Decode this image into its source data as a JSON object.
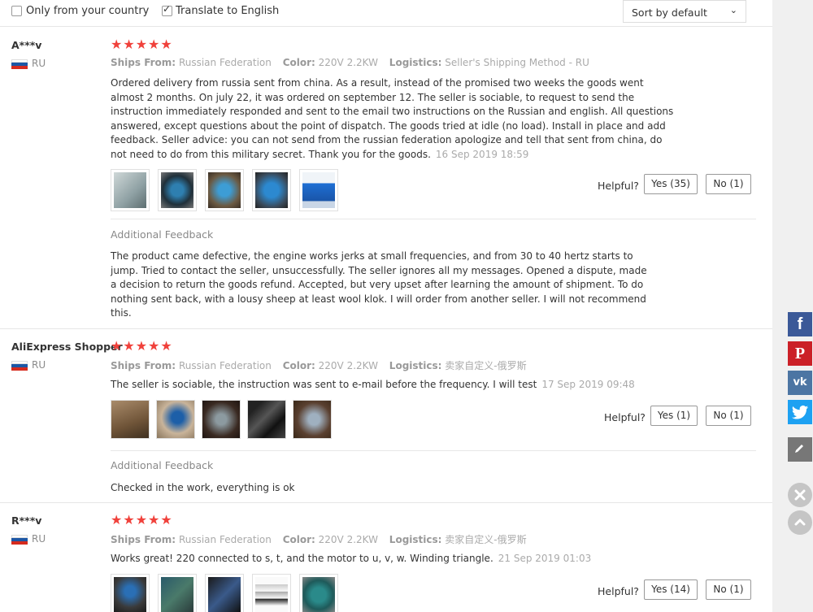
{
  "filters": {
    "only_country_label": "Only from your country",
    "translate_label": "Translate to English",
    "sort_value": "Sort by default"
  },
  "labels": {
    "ships_from": "Ships From:",
    "color": "Color:",
    "logistics": "Logistics:",
    "helpful": "Helpful?",
    "additional_feedback": "Additional Feedback"
  },
  "reviews": [
    {
      "user": "A***v",
      "country": "RU",
      "stars": "★★★★★",
      "ships_from": "Russian Federation",
      "color": "220V 2.2KW",
      "logistics": "Seller's Shipping Method - RU",
      "text": "Ordered delivery from russia sent from china. As a result, instead of the promised two weeks the goods went almost 2 months. On july 22, it was ordered on september 12. The seller is sociable, to request to send the instruction immediately responded and sent to the email two instructions on the Russian and english. All questions answered, except questions about the point of dispatch. The goods tried at idle (no load). Install in place and add feedback. Seller advice: you can not send from the russian federation apologize and tell that sent from china, do not need to do from this military secret. Thank you for the goods.",
      "time": "16 Sep 2019 18:59",
      "yes": "Yes (35)",
      "no": "No (1)",
      "additional": "The product came defective, the engine works jerks at small frequencies, and from 30 to 40 hertz starts to jump. Tried to contact the seller, unsuccessfully. The seller ignores all my messages. Opened a dispute, made a decision to return the goods refund. Accepted, but very upset after learning the amount of shipment. To do nothing sent back, with a lousy sheep at least wool klok. I will order from another seller. I will not recommend this."
    },
    {
      "user": "AliExpress Shopper",
      "country": "RU",
      "stars": "★★★★★",
      "ships_from": "Russian Federation",
      "color": "220V 2.2KW",
      "logistics": "卖家自定义-俄罗斯",
      "text": "The seller is sociable, the instruction was sent to e-mail before the frequency. I will test",
      "time": "17 Sep 2019 09:48",
      "yes": "Yes (1)",
      "no": "No (1)",
      "additional": "Checked in the work, everything is ok"
    },
    {
      "user": "R***v",
      "country": "RU",
      "stars": "★★★★★",
      "ships_from": "Russian Federation",
      "color": "220V 2.2KW",
      "logistics": "卖家自定义-俄罗斯",
      "text": "Works great! 220 connected to s, t, and the motor to u, v, w. Winding triangle.",
      "time": "21 Sep 2019 01:03",
      "yes": "Yes (14)",
      "no": "No (1)"
    }
  ],
  "share": {
    "facebook": "f",
    "pinterest": "P",
    "vk": "vk"
  },
  "colors": {
    "star": "#f0413b",
    "facebook": "#3b5998",
    "pinterest": "#cb2027",
    "vk": "#4c75a3",
    "twitter": "#1da1f2",
    "edit": "#777777"
  }
}
